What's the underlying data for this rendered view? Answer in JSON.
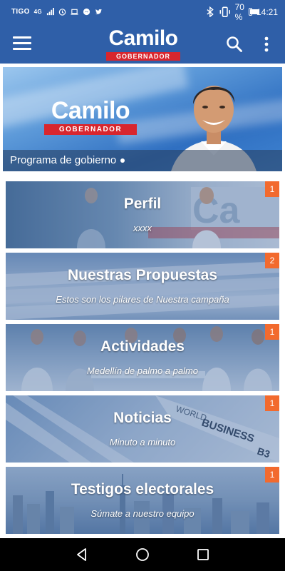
{
  "status_bar": {
    "carrier": "TIGO",
    "network": "4G",
    "battery": "70 %",
    "battery_level": 0.7,
    "time": "14:21"
  },
  "app_bar": {
    "logo_name": "Camilo",
    "logo_tag": "GOBERNADOR",
    "icons": [
      "menu-icon",
      "search-icon",
      "more-vert-icon"
    ]
  },
  "hero": {
    "logo_name": "Camilo",
    "logo_tag": "GOBERNADOR",
    "caption": "Programa de gobierno"
  },
  "cards": [
    {
      "title": "Perfil",
      "subtitle": "xxxx",
      "badge": "1"
    },
    {
      "title": "Nuestras Propuestas",
      "subtitle": "Estos son los pilares de Nuestra campaña",
      "badge": "2"
    },
    {
      "title": "Actividades",
      "subtitle": "Medellín de palmo a palmo",
      "badge": "1"
    },
    {
      "title": "Noticias",
      "subtitle": "Minuto a minuto",
      "badge": "1"
    },
    {
      "title": "Testigos electorales",
      "subtitle": "Súmate a nuestro equipo",
      "badge": "1"
    }
  ],
  "colors": {
    "primary": "#2f5fa8",
    "accent_red": "#d8262e",
    "badge_orange": "#f26a2e"
  }
}
